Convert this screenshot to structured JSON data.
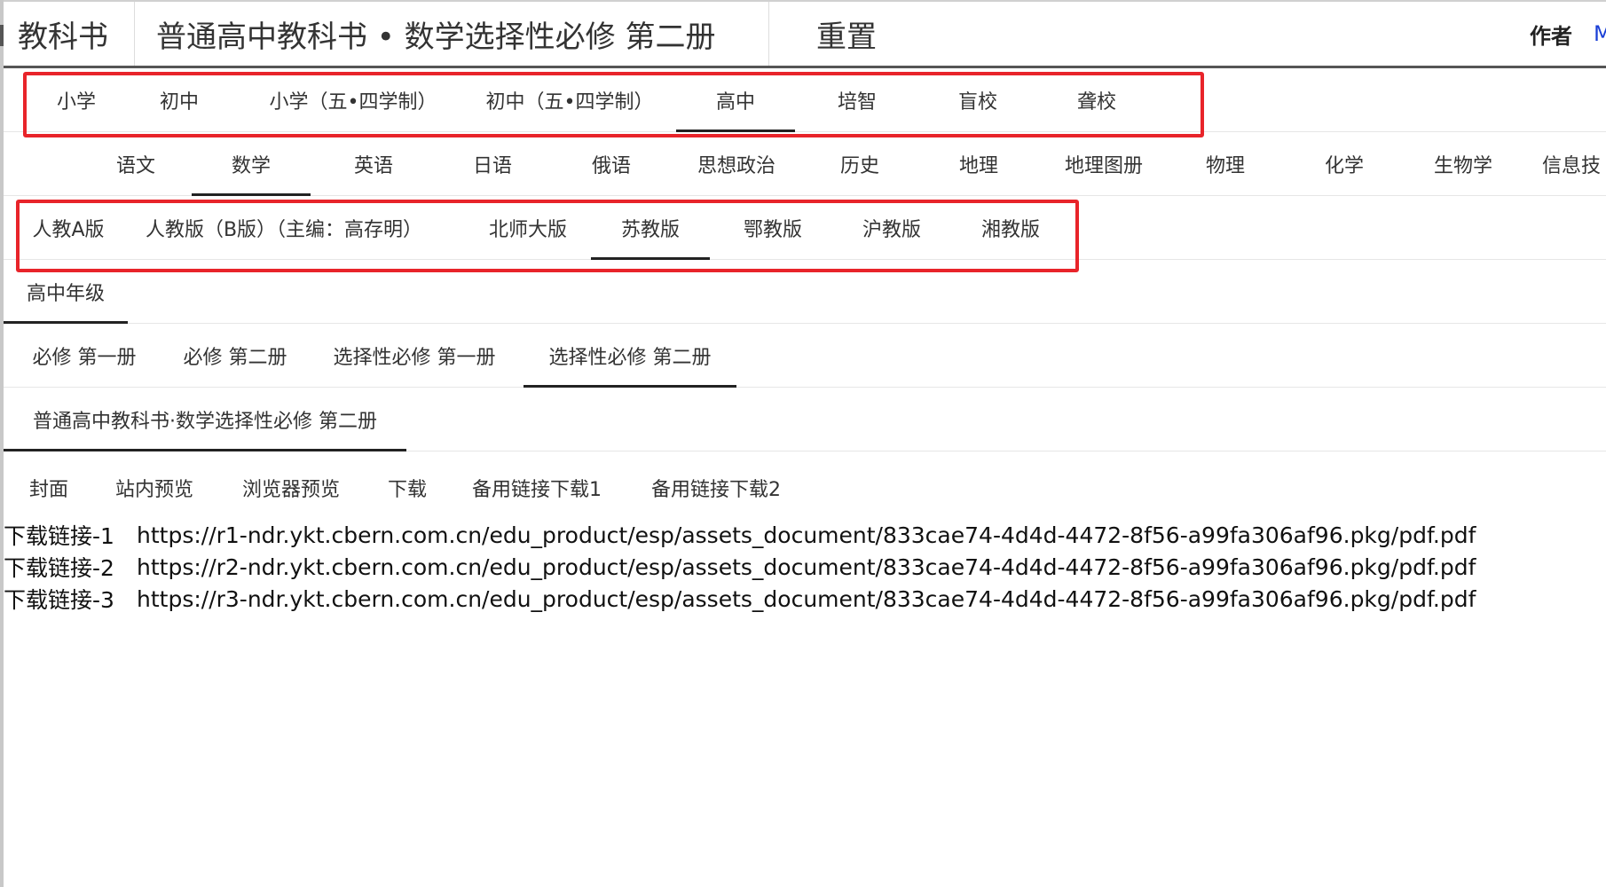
{
  "header": {
    "site_title": "教科书",
    "book_title": "普通高中教科书 • 数学选择性必修 第二册",
    "reset_label": "重置",
    "author_label": "作者",
    "author_link": "M"
  },
  "stages": {
    "items": [
      "小学",
      "初中",
      "小学（五•四学制）",
      "初中（五•四学制）",
      "高中",
      "培智",
      "盲校",
      "聋校"
    ],
    "active_index": 4
  },
  "subjects": {
    "items": [
      "语文",
      "数学",
      "英语",
      "日语",
      "俄语",
      "思想政治",
      "历史",
      "地理",
      "地理图册",
      "物理",
      "化学",
      "生物学",
      "信息技"
    ],
    "active_index": 1
  },
  "editions": {
    "items": [
      "人教A版",
      "人教版（B版）（主编：高存明）",
      "北师大版",
      "苏教版",
      "鄂教版",
      "沪教版",
      "湘教版"
    ],
    "active_index": 3
  },
  "grades": {
    "items": [
      "高中年级"
    ],
    "active_index": 0
  },
  "volumes": {
    "items": [
      "必修 第一册",
      "必修 第二册",
      "选择性必修 第一册",
      "选择性必修 第二册"
    ],
    "active_index": 3
  },
  "books": {
    "items": [
      "普通高中教科书·数学选择性必修 第二册"
    ],
    "active_index": 0
  },
  "actions": [
    "封面",
    "站内预览",
    "浏览器预览",
    "下载",
    "备用链接下载1",
    "备用链接下载2"
  ],
  "download_links": [
    {
      "label": "下载链接-1",
      "url": "https://r1-ndr.ykt.cbern.com.cn/edu_product/esp/assets_document/833cae74-4d4d-4472-8f56-a99fa306af96.pkg/pdf.pdf"
    },
    {
      "label": "下载链接-2",
      "url": "https://r2-ndr.ykt.cbern.com.cn/edu_product/esp/assets_document/833cae74-4d4d-4472-8f56-a99fa306af96.pkg/pdf.pdf"
    },
    {
      "label": "下载链接-3",
      "url": "https://r3-ndr.ykt.cbern.com.cn/edu_product/esp/assets_document/833cae74-4d4d-4472-8f56-a99fa306af96.pkg/pdf.pdf"
    }
  ],
  "colors": {
    "highlight_box": "#e8242a",
    "active_underline": "#222222",
    "author_link": "#1a3fd6"
  }
}
